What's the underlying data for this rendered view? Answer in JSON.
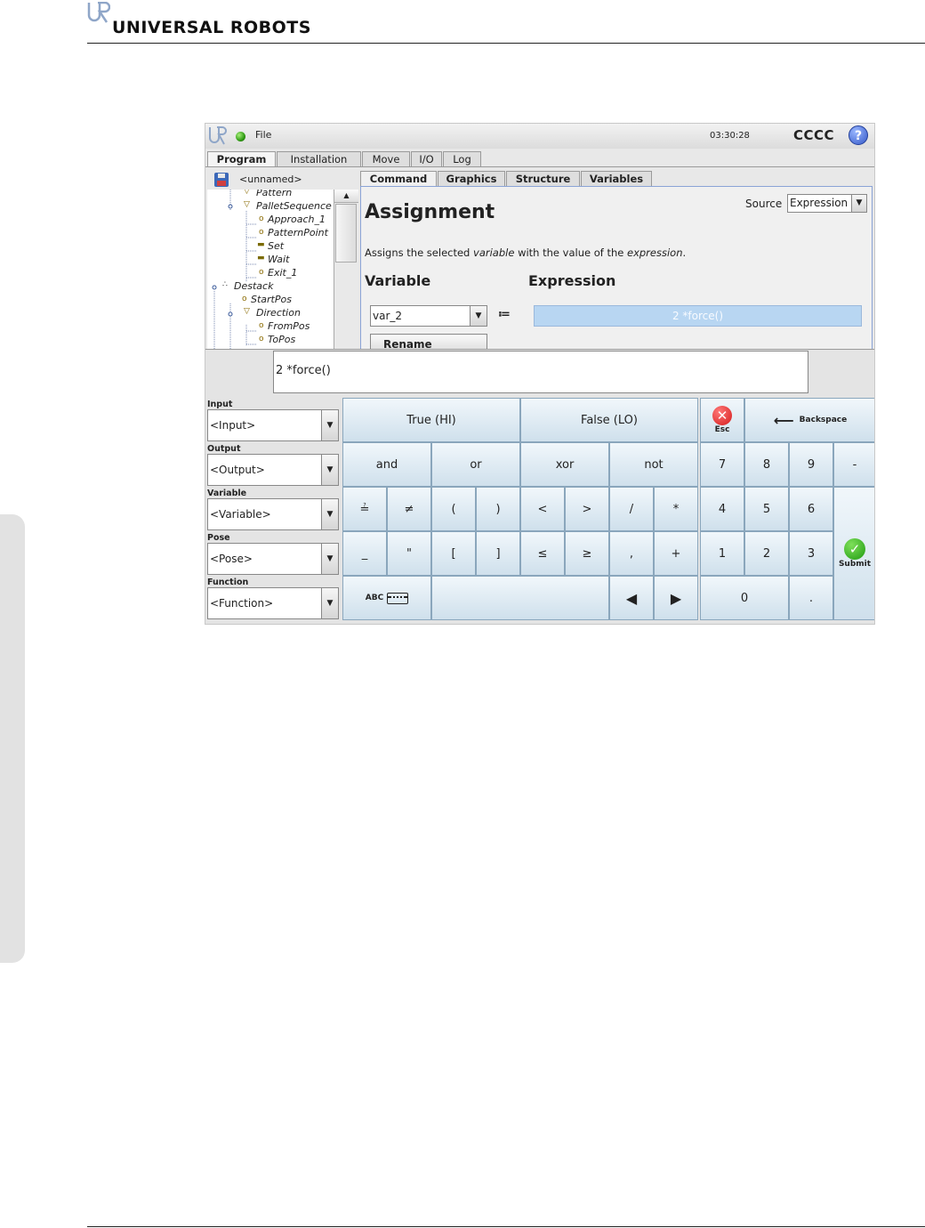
{
  "brand": {
    "name": "UNIVERSAL ROBOTS",
    "logo_icon": "ur-logo-icon"
  },
  "topbar": {
    "menu_file": "File",
    "clock": "03:30:28",
    "robot_name": "CCCC",
    "help": "?"
  },
  "main_tabs": [
    "Program",
    "Installation",
    "Move",
    "I/O",
    "Log"
  ],
  "file": {
    "name": "<unnamed>"
  },
  "tree": [
    {
      "label": "Pattern",
      "icon": "pattern-icon"
    },
    {
      "label": "PalletSequence",
      "icon": "pattern-icon"
    },
    {
      "label": "Approach_1",
      "icon": "waypoint-icon"
    },
    {
      "label": "PatternPoint",
      "icon": "waypoint-icon"
    },
    {
      "label": "Set",
      "icon": "set-icon"
    },
    {
      "label": "Wait",
      "icon": "wait-icon"
    },
    {
      "label": "Exit_1",
      "icon": "waypoint-icon"
    },
    {
      "label": "Destack",
      "icon": "destack-icon"
    },
    {
      "label": "StartPos",
      "icon": "waypoint-icon"
    },
    {
      "label": "Direction",
      "icon": "direction-icon"
    },
    {
      "label": "FromPos",
      "icon": "waypoint-icon"
    },
    {
      "label": "ToPos",
      "icon": "waypoint-icon"
    }
  ],
  "sub_tabs": [
    "Command",
    "Graphics",
    "Structure",
    "Variables"
  ],
  "command": {
    "title": "Assignment",
    "source_label": "Source",
    "source_value": "Expression",
    "description_parts": [
      "Assigns the selected ",
      "variable",
      " with the value of the ",
      "expression",
      "."
    ],
    "variable_heading": "Variable",
    "expression_heading": "Expression",
    "variable_value": "var_2",
    "assign_symbol": "≔",
    "expression_value": "2 *force()",
    "rename_label": "Rename"
  },
  "keypad": {
    "expression_input": "2 *force()",
    "selectors": [
      {
        "label": "Input",
        "value": "<Input>"
      },
      {
        "label": "Output",
        "value": "<Output>"
      },
      {
        "label": "Variable",
        "value": "<Variable>"
      },
      {
        "label": "Pose",
        "value": "<Pose>"
      },
      {
        "label": "Function",
        "value": "<Function>"
      }
    ],
    "true_label": "True (HI)",
    "false_label": "False (LO)",
    "esc_label": "Esc",
    "backspace_label": "Backspace",
    "logic_keys": [
      "and",
      "or",
      "xor",
      "not"
    ],
    "op_row1": [
      "≟",
      "≠",
      "(",
      ")",
      "<",
      ">",
      "/",
      "*"
    ],
    "op_row2": [
      "_",
      "\"",
      "[",
      "]",
      "≤",
      "≥",
      ",",
      "+"
    ],
    "digits_row1": [
      "7",
      "8",
      "9",
      "-"
    ],
    "digits_row2": [
      "4",
      "5",
      "6"
    ],
    "digits_row3": [
      "1",
      "2",
      "3"
    ],
    "zero": "0",
    "dot": ".",
    "submit_label": "Submit",
    "abc_label": "ABC"
  }
}
